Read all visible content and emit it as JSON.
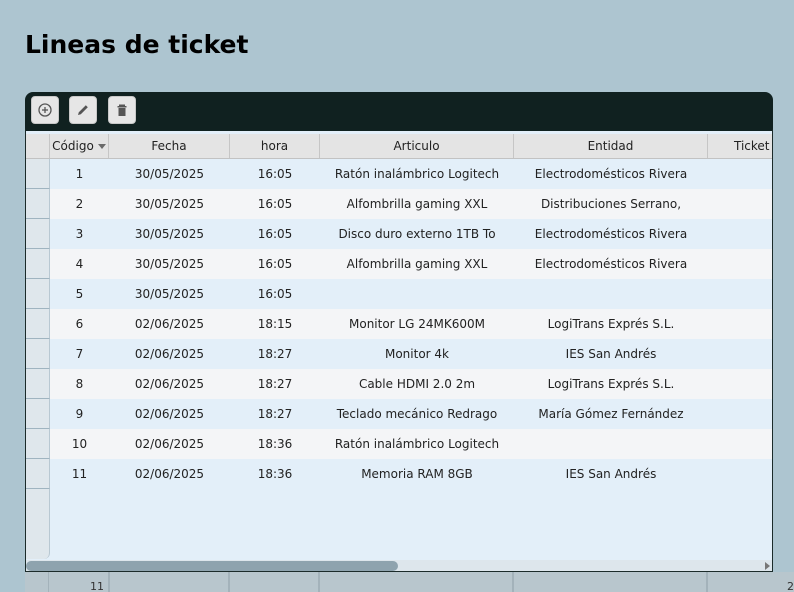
{
  "page": {
    "title": "Lineas de ticket"
  },
  "toolbar": {
    "buttons": [
      {
        "name": "add-button",
        "icon": "plus-circle-icon"
      },
      {
        "name": "edit-button",
        "icon": "pencil-icon"
      },
      {
        "name": "delete-button",
        "icon": "trash-icon"
      }
    ]
  },
  "table": {
    "columns": [
      "Código",
      "Fecha",
      "hora",
      "Articulo",
      "Entidad",
      "Ticket"
    ],
    "sorted_column": "Código",
    "rows": [
      [
        "1",
        "30/05/2025",
        "16:05",
        "Ratón inalámbrico Logitech",
        "Electrodomésticos Rivera",
        ""
      ],
      [
        "2",
        "30/05/2025",
        "16:05",
        "Alfombrilla gaming XXL",
        "Distribuciones Serrano,",
        ""
      ],
      [
        "3",
        "30/05/2025",
        "16:05",
        "Disco duro externo 1TB To",
        "Electrodomésticos Rivera",
        ""
      ],
      [
        "4",
        "30/05/2025",
        "16:05",
        "Alfombrilla gaming XXL",
        "Electrodomésticos Rivera",
        ""
      ],
      [
        "5",
        "30/05/2025",
        "16:05",
        "",
        "",
        ""
      ],
      [
        "6",
        "02/06/2025",
        "18:15",
        "Monitor LG 24MK600M",
        "LogiTrans Exprés S.L.",
        ""
      ],
      [
        "7",
        "02/06/2025",
        "18:27",
        "Monitor 4k",
        "IES San Andrés",
        ""
      ],
      [
        "8",
        "02/06/2025",
        "18:27",
        "Cable HDMI 2.0 2m",
        "LogiTrans Exprés S.L.",
        ""
      ],
      [
        "9",
        "02/06/2025",
        "18:27",
        "Teclado mecánico Redrago",
        "María Gómez Fernández",
        ""
      ],
      [
        "10",
        "02/06/2025",
        "18:36",
        "Ratón inalámbrico Logitech",
        "",
        ""
      ],
      [
        "11",
        "02/06/2025",
        "18:36",
        "Memoria RAM 8GB",
        "IES San Andrés",
        ""
      ]
    ],
    "footer": {
      "count": "11",
      "ticket_total": "2"
    }
  },
  "colors": {
    "background": "#adc5d0",
    "toolbar": "#102120",
    "row_even": "#e3eff9",
    "row_odd": "#f4f5f7",
    "header": "#e4e4e4"
  }
}
